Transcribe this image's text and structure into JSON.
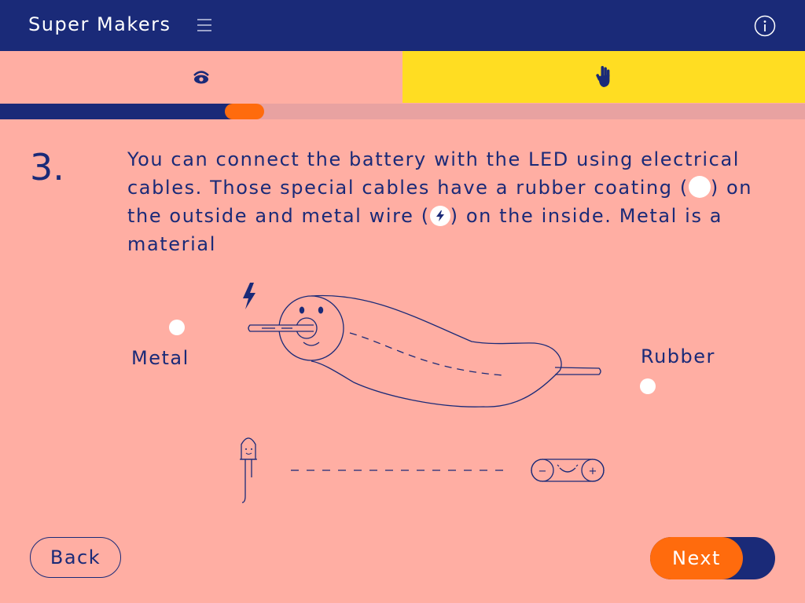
{
  "header": {
    "app_title": "Super Makers",
    "menu_icon": "hamburger-menu-icon",
    "info_icon": "info-icon"
  },
  "tabs": [
    {
      "icon": "eye-icon",
      "color": "#ffaea3"
    },
    {
      "icon": "hand-icon",
      "color": "#ffdd22"
    }
  ],
  "progress": {
    "fraction": 0.3
  },
  "step": {
    "number": "3.",
    "text_part1": "You can connect the battery with the LED using electrical cables. Those special cables have a rubber coating (",
    "text_part2": ") on the outside and metal wire (",
    "text_part3": ") on the inside. Metal is a material"
  },
  "illustration": {
    "metal_label": "Metal",
    "rubber_label": "Rubber",
    "lightning_icon": "lightning-bolt-icon",
    "battery_minus": "−",
    "battery_plus": "+"
  },
  "nav": {
    "back_label": "Back",
    "next_label": "Next"
  },
  "colors": {
    "navy": "#1a2a78",
    "salmon": "#ffaea3",
    "yellow": "#ffdd22",
    "orange": "#ff6b0d",
    "track": "#e8a2a1"
  }
}
